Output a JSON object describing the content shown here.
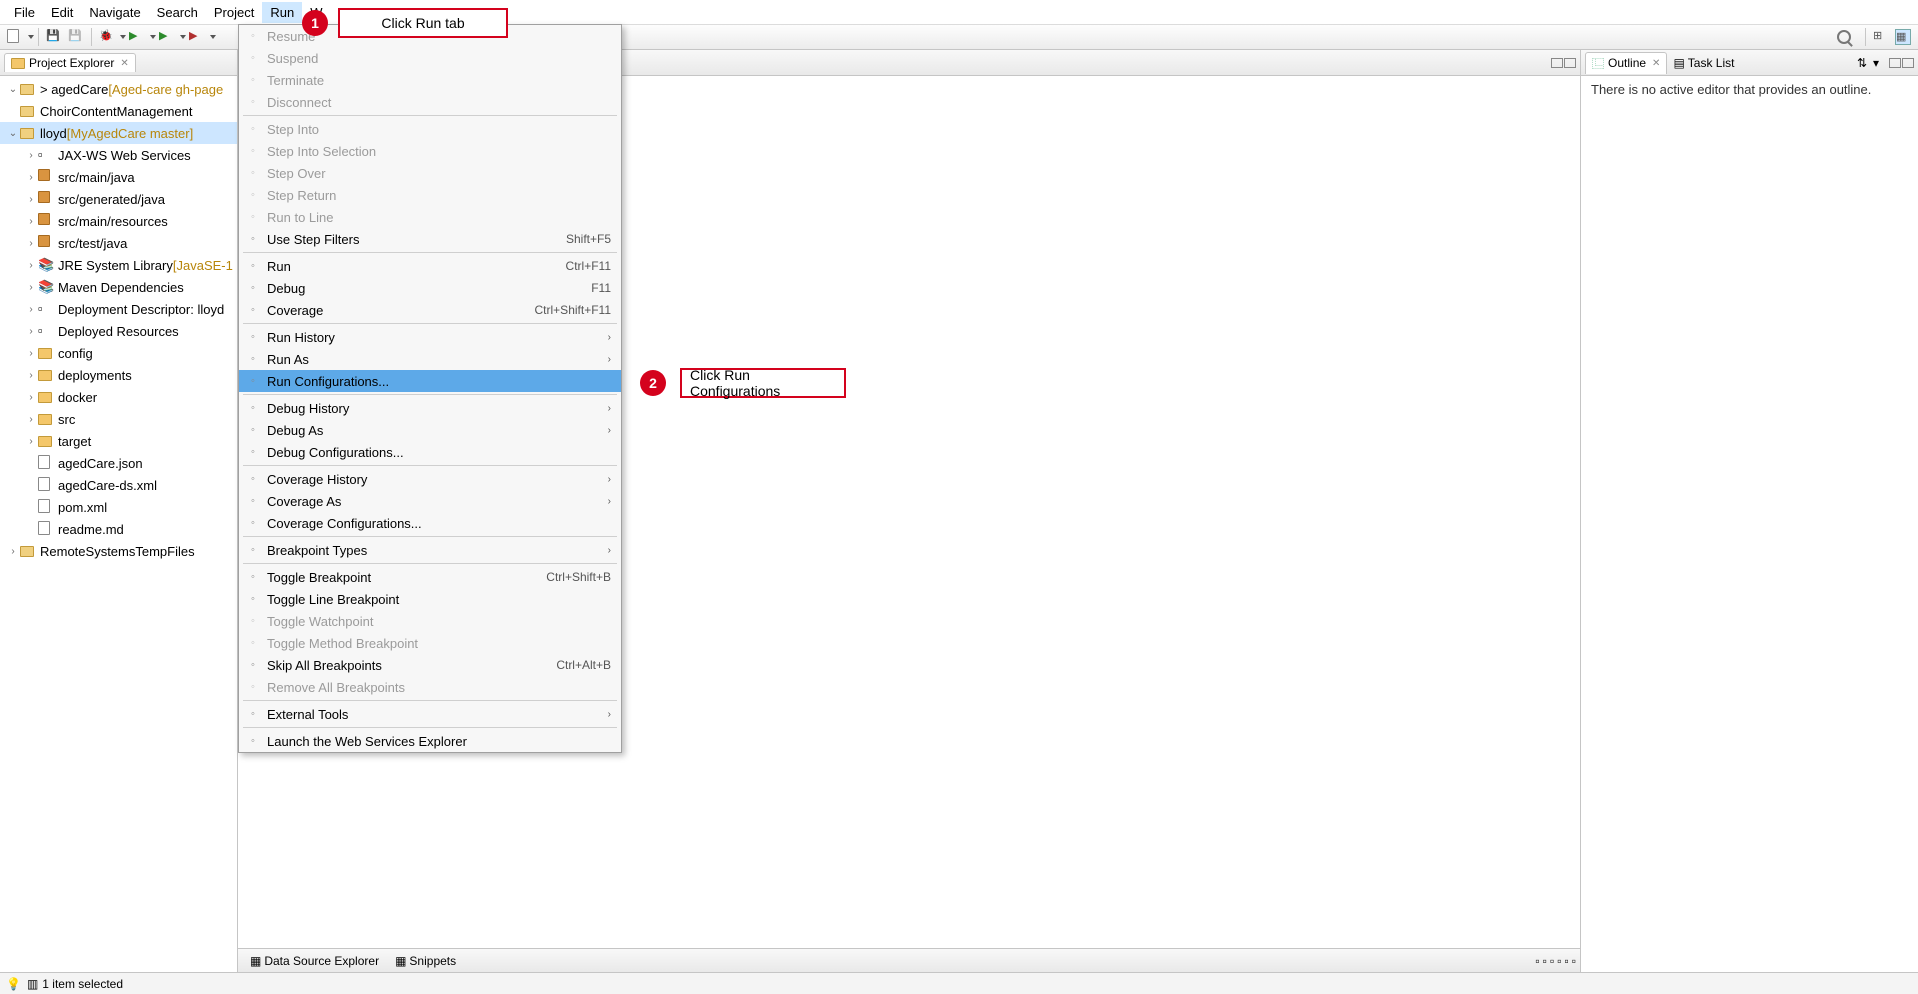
{
  "menubar": [
    "File",
    "Edit",
    "Navigate",
    "Search",
    "Project",
    "Run",
    "W"
  ],
  "menubar_active_index": 5,
  "left": {
    "title": "Project Explorer",
    "tree": [
      {
        "depth": 0,
        "twist": "v",
        "icon": "proj",
        "label": "> agedCare",
        "deco": " [Aged-care gh-page"
      },
      {
        "depth": 0,
        "twist": "",
        "icon": "proj",
        "label": "ChoirContentManagement",
        "deco": ""
      },
      {
        "depth": 0,
        "twist": "v",
        "icon": "proj-sel",
        "label": "lloyd",
        "deco": " [MyAgedCare master]",
        "selected": true
      },
      {
        "depth": 1,
        "twist": ">",
        "icon": "ws",
        "label": "JAX-WS Web Services",
        "deco": ""
      },
      {
        "depth": 1,
        "twist": ">",
        "icon": "pkg",
        "label": "src/main/java",
        "deco": ""
      },
      {
        "depth": 1,
        "twist": ">",
        "icon": "pkg",
        "label": "src/generated/java",
        "deco": ""
      },
      {
        "depth": 1,
        "twist": ">",
        "icon": "pkg",
        "label": "src/main/resources",
        "deco": ""
      },
      {
        "depth": 1,
        "twist": ">",
        "icon": "pkg",
        "label": "src/test/java",
        "deco": ""
      },
      {
        "depth": 1,
        "twist": ">",
        "icon": "lib",
        "label": "JRE System Library",
        "deco": " [JavaSE-1"
      },
      {
        "depth": 1,
        "twist": ">",
        "icon": "lib",
        "label": "Maven Dependencies",
        "deco": ""
      },
      {
        "depth": 1,
        "twist": ">",
        "icon": "dd",
        "label": "Deployment Descriptor: lloyd",
        "deco": ""
      },
      {
        "depth": 1,
        "twist": ">",
        "icon": "dep",
        "label": "Deployed Resources",
        "deco": ""
      },
      {
        "depth": 1,
        "twist": ">",
        "icon": "folder",
        "label": "config",
        "deco": ""
      },
      {
        "depth": 1,
        "twist": ">",
        "icon": "folder",
        "label": "deployments",
        "deco": ""
      },
      {
        "depth": 1,
        "twist": ">",
        "icon": "folder",
        "label": "docker",
        "deco": ""
      },
      {
        "depth": 1,
        "twist": ">",
        "icon": "folder",
        "label": "src",
        "deco": ""
      },
      {
        "depth": 1,
        "twist": ">",
        "icon": "folder",
        "label": "target",
        "deco": ""
      },
      {
        "depth": 1,
        "twist": "",
        "icon": "file",
        "label": "agedCare.json",
        "deco": ""
      },
      {
        "depth": 1,
        "twist": "",
        "icon": "file",
        "label": "agedCare-ds.xml",
        "deco": ""
      },
      {
        "depth": 1,
        "twist": "",
        "icon": "file",
        "label": "pom.xml",
        "deco": ""
      },
      {
        "depth": 1,
        "twist": "",
        "icon": "file",
        "label": "readme.md",
        "deco": ""
      },
      {
        "depth": 0,
        "twist": ">",
        "icon": "proj",
        "label": "RemoteSystemsTempFiles",
        "deco": ""
      }
    ]
  },
  "run_menu": [
    {
      "label": "Resume",
      "accel": "",
      "submenu": false,
      "disabled": true
    },
    {
      "label": "Suspend",
      "accel": "",
      "submenu": false,
      "disabled": true
    },
    {
      "label": "Terminate",
      "accel": "",
      "submenu": false,
      "disabled": true
    },
    {
      "label": "Disconnect",
      "accel": "",
      "submenu": false,
      "disabled": true
    },
    {
      "sep": true
    },
    {
      "label": "Step Into",
      "accel": "",
      "submenu": false,
      "disabled": true
    },
    {
      "label": "Step Into Selection",
      "accel": "",
      "submenu": false,
      "disabled": true
    },
    {
      "label": "Step Over",
      "accel": "",
      "submenu": false,
      "disabled": true
    },
    {
      "label": "Step Return",
      "accel": "",
      "submenu": false,
      "disabled": true
    },
    {
      "label": "Run to Line",
      "accel": "",
      "submenu": false,
      "disabled": true
    },
    {
      "label": "Use Step Filters",
      "accel": "Shift+F5",
      "submenu": false,
      "disabled": false
    },
    {
      "sep": true
    },
    {
      "label": "Run",
      "accel": "Ctrl+F11",
      "submenu": false,
      "disabled": false
    },
    {
      "label": "Debug",
      "accel": "F11",
      "submenu": false,
      "disabled": false
    },
    {
      "label": "Coverage",
      "accel": "Ctrl+Shift+F11",
      "submenu": false,
      "disabled": false
    },
    {
      "sep": true
    },
    {
      "label": "Run History",
      "accel": "",
      "submenu": true,
      "disabled": false
    },
    {
      "label": "Run As",
      "accel": "",
      "submenu": true,
      "disabled": false
    },
    {
      "label": "Run Configurations...",
      "accel": "",
      "submenu": false,
      "disabled": false,
      "selected": true
    },
    {
      "sep": true
    },
    {
      "label": "Debug History",
      "accel": "",
      "submenu": true,
      "disabled": false
    },
    {
      "label": "Debug As",
      "accel": "",
      "submenu": true,
      "disabled": false
    },
    {
      "label": "Debug Configurations...",
      "accel": "",
      "submenu": false,
      "disabled": false
    },
    {
      "sep": true
    },
    {
      "label": "Coverage History",
      "accel": "",
      "submenu": true,
      "disabled": false
    },
    {
      "label": "Coverage As",
      "accel": "",
      "submenu": true,
      "disabled": false
    },
    {
      "label": "Coverage Configurations...",
      "accel": "",
      "submenu": false,
      "disabled": false
    },
    {
      "sep": true
    },
    {
      "label": "Breakpoint Types",
      "accel": "",
      "submenu": true,
      "disabled": false
    },
    {
      "sep": true
    },
    {
      "label": "Toggle Breakpoint",
      "accel": "Ctrl+Shift+B",
      "submenu": false,
      "disabled": false
    },
    {
      "label": "Toggle Line Breakpoint",
      "accel": "",
      "submenu": false,
      "disabled": false
    },
    {
      "label": "Toggle Watchpoint",
      "accel": "",
      "submenu": false,
      "disabled": true
    },
    {
      "label": "Toggle Method Breakpoint",
      "accel": "",
      "submenu": false,
      "disabled": true
    },
    {
      "label": "Skip All Breakpoints",
      "accel": "Ctrl+Alt+B",
      "submenu": false,
      "disabled": false
    },
    {
      "label": "Remove All Breakpoints",
      "accel": "",
      "submenu": false,
      "disabled": true
    },
    {
      "sep": true
    },
    {
      "label": "External Tools",
      "accel": "",
      "submenu": true,
      "disabled": false
    },
    {
      "sep": true
    },
    {
      "label": "Launch the Web Services Explorer",
      "accel": "",
      "submenu": false,
      "disabled": false
    }
  ],
  "bottom_tabs": [
    "Data Source Explorer",
    "Snippets"
  ],
  "right": {
    "tab1": "Outline",
    "tab2": "Task List",
    "body": "There is no active editor that provides an outline."
  },
  "anno": {
    "badge1": "1",
    "label1": "Click Run tab",
    "badge2": "2",
    "label2": "Click Run Configurations"
  },
  "status": "1 item selected"
}
